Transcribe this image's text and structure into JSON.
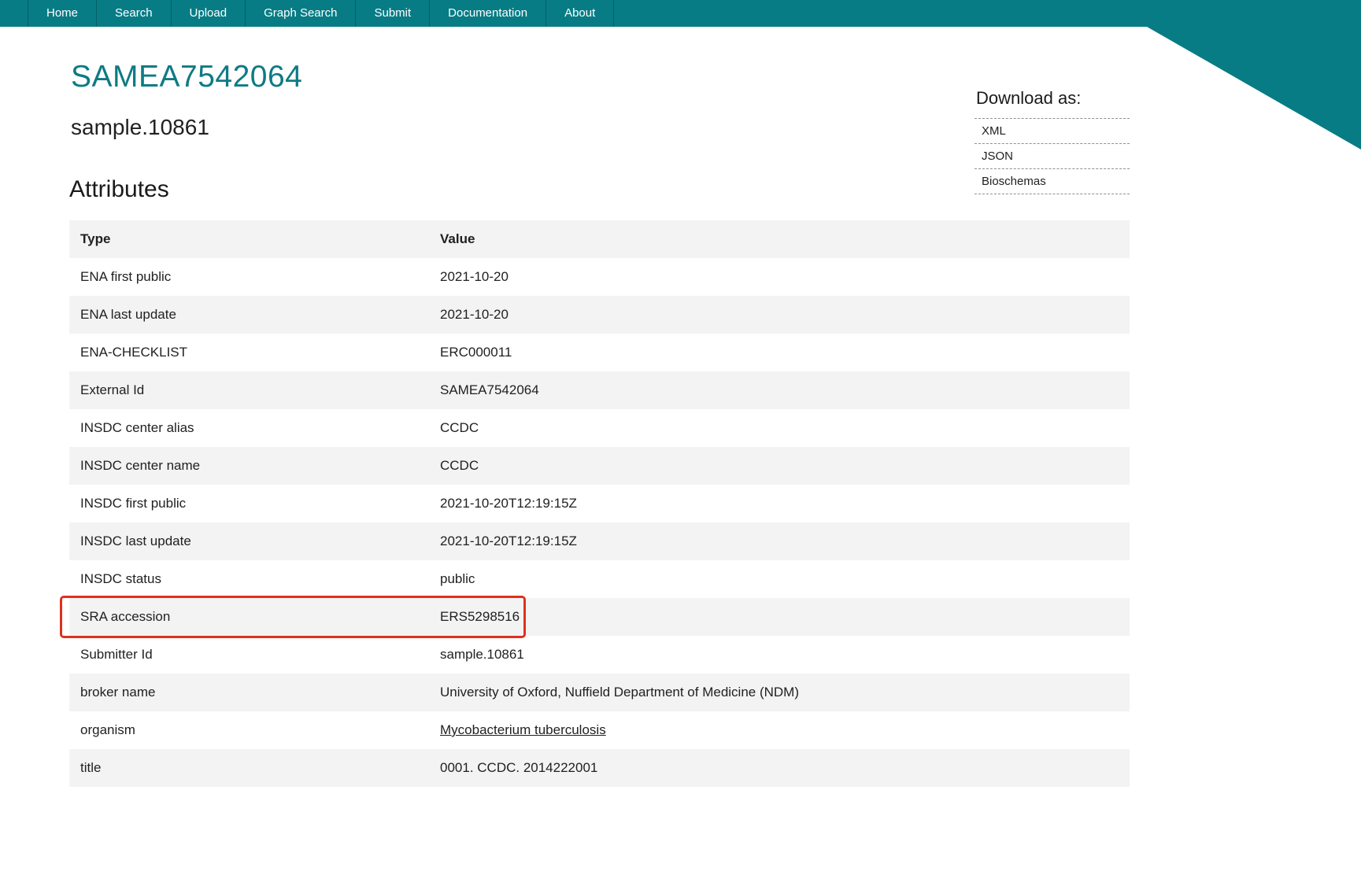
{
  "nav": {
    "items": [
      {
        "label": "Home"
      },
      {
        "label": "Search"
      },
      {
        "label": "Upload"
      },
      {
        "label": "Graph Search"
      },
      {
        "label": "Submit"
      },
      {
        "label": "Documentation"
      },
      {
        "label": "About"
      }
    ]
  },
  "page": {
    "accession": "SAMEA7542064",
    "sample_name": "sample.10861",
    "section_heading": "Attributes"
  },
  "download": {
    "label": "Download as:",
    "options": [
      {
        "label": "XML"
      },
      {
        "label": "JSON"
      },
      {
        "label": "Bioschemas"
      }
    ]
  },
  "attributes_table": {
    "columns": {
      "type": "Type",
      "value": "Value"
    },
    "rows": [
      {
        "type": "ENA first public",
        "value": "2021-10-20"
      },
      {
        "type": "ENA last update",
        "value": "2021-10-20"
      },
      {
        "type": "ENA-CHECKLIST",
        "value": "ERC000011"
      },
      {
        "type": "External Id",
        "value": "SAMEA7542064"
      },
      {
        "type": "INSDC center alias",
        "value": "CCDC"
      },
      {
        "type": "INSDC center name",
        "value": "CCDC"
      },
      {
        "type": "INSDC first public",
        "value": "2021-10-20T12:19:15Z"
      },
      {
        "type": "INSDC last update",
        "value": "2021-10-20T12:19:15Z"
      },
      {
        "type": "INSDC status",
        "value": "public"
      },
      {
        "type": "SRA accession",
        "value": "ERS5298516",
        "highlighted": true
      },
      {
        "type": "Submitter Id",
        "value": "sample.10861"
      },
      {
        "type": "broker name",
        "value": "University of Oxford, Nuffield Department of Medicine (NDM)"
      },
      {
        "type": "organism",
        "value": "Mycobacterium tuberculosis",
        "link": true
      },
      {
        "type": "title",
        "value": "0001. CCDC. 2014222001"
      }
    ]
  },
  "annotation": {
    "shape": "rectangle",
    "target_row": "SRA accession",
    "color": "#e0301e"
  },
  "colors": {
    "accent_teal": "#077c85",
    "title_teal": "#0d7b84",
    "stripe_gray": "#f3f3f3"
  }
}
